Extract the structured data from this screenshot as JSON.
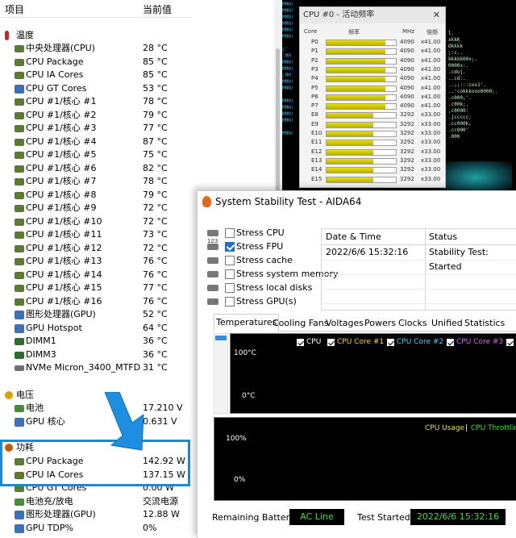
{
  "sensor_panel": {
    "col_item": "项目",
    "col_value": "当前值",
    "sections": {
      "temperature": "温度",
      "voltage": "电压",
      "power": "功耗"
    },
    "temps": [
      {
        "label": "中央处理器(CPU)",
        "value": "28 °C"
      },
      {
        "label": "CPU Package",
        "value": "85 °C"
      },
      {
        "label": "CPU IA Cores",
        "value": "85 °C"
      },
      {
        "label": "CPU GT Cores",
        "value": "53 °C"
      },
      {
        "label": "CPU #1/核心 #1",
        "value": "78 °C"
      },
      {
        "label": "CPU #1/核心 #2",
        "value": "79 °C"
      },
      {
        "label": "CPU #1/核心 #3",
        "value": "77 °C"
      },
      {
        "label": "CPU #1/核心 #4",
        "value": "87 °C"
      },
      {
        "label": "CPU #1/核心 #5",
        "value": "75 °C"
      },
      {
        "label": "CPU #1/核心 #6",
        "value": "82 °C"
      },
      {
        "label": "CPU #1/核心 #7",
        "value": "78 °C"
      },
      {
        "label": "CPU #1/核心 #8",
        "value": "79 °C"
      },
      {
        "label": "CPU #1/核心 #9",
        "value": "72 °C"
      },
      {
        "label": "CPU #1/核心 #10",
        "value": "72 °C"
      },
      {
        "label": "CPU #1/核心 #11",
        "value": "73 °C"
      },
      {
        "label": "CPU #1/核心 #12",
        "value": "72 °C"
      },
      {
        "label": "CPU #1/核心 #13",
        "value": "76 °C"
      },
      {
        "label": "CPU #1/核心 #14",
        "value": "76 °C"
      },
      {
        "label": "CPU #1/核心 #15",
        "value": "77 °C"
      },
      {
        "label": "CPU #1/核心 #16",
        "value": "76 °C"
      },
      {
        "label": "图形处理器(GPU)",
        "value": "52 °C"
      },
      {
        "label": "GPU Hotspot",
        "value": "64 °C"
      },
      {
        "label": "DIMM1",
        "value": "36 °C"
      },
      {
        "label": "DIMM3",
        "value": "36 °C"
      },
      {
        "label": "NVMe Micron_3400_MTFD",
        "value": "31 °C"
      }
    ],
    "volts": [
      {
        "label": "电池",
        "value": "17.210 V"
      },
      {
        "label": "GPU 核心",
        "value": "0.631 V"
      }
    ],
    "power": [
      {
        "label": "CPU Package",
        "value": "142.92 W"
      },
      {
        "label": "CPU IA Cores",
        "value": "137.15 W"
      },
      {
        "label": "CPU GT Cores",
        "value": "0.00 W"
      },
      {
        "label": "电池充/放电",
        "value": "交流电源"
      },
      {
        "label": "图形处理器(GPU)",
        "value": "12.88 W"
      },
      {
        "label": "GPU TDP%",
        "value": "0%"
      }
    ]
  },
  "freq_window": {
    "title": "CPU #0 - 活动频率",
    "close": "✕",
    "col_core": "Core",
    "col_freq": "频率",
    "col_mhz": "MHz",
    "col_mult": "倍频",
    "rows": [
      {
        "core": "P0",
        "mhz": "4090",
        "mult": "x41.00",
        "level": 0.85
      },
      {
        "core": "P1",
        "mhz": "4090",
        "mult": "x41.00",
        "level": 0.85
      },
      {
        "core": "P2",
        "mhz": "4090",
        "mult": "x41.00",
        "level": 0.85
      },
      {
        "core": "P3",
        "mhz": "4090",
        "mult": "x41.00",
        "level": 0.85
      },
      {
        "core": "P4",
        "mhz": "4090",
        "mult": "x41.00",
        "level": 0.85
      },
      {
        "core": "P5",
        "mhz": "4090",
        "mult": "x41.00",
        "level": 0.85
      },
      {
        "core": "P6",
        "mhz": "4090",
        "mult": "x41.00",
        "level": 0.85
      },
      {
        "core": "P7",
        "mhz": "4090",
        "mult": "x41.00",
        "level": 0.85
      },
      {
        "core": "E8",
        "mhz": "3292",
        "mult": "x33.00",
        "level": 0.68
      },
      {
        "core": "E9",
        "mhz": "3292",
        "mult": "x33.00",
        "level": 0.68
      },
      {
        "core": "E10",
        "mhz": "3292",
        "mult": "x33.00",
        "level": 0.68
      },
      {
        "core": "E11",
        "mhz": "3292",
        "mult": "x33.00",
        "level": 0.68
      },
      {
        "core": "E12",
        "mhz": "3292",
        "mult": "x33.00",
        "level": 0.68
      },
      {
        "core": "E13",
        "mhz": "3292",
        "mult": "x33.00",
        "level": 0.68
      },
      {
        "core": "E14",
        "mhz": "3292",
        "mult": "x33.00",
        "level": 0.68
      },
      {
        "core": "E15",
        "mhz": "3292",
        "mult": "x33.00",
        "level": 0.68
      }
    ]
  },
  "terminal": {
    "left_text": "MMN!\nMMN!\nMMN!\nMMN!\nMMN!\nMMN!\n\nc'\n:MM\nMMN!\nMMN!\n;MM\nMMN!\nMMN!\n\nMMN!\nMMN!\nMMN!\nMMN!\n\nMMN!",
    "right_text": "l.\nxkkK\nOkkkk\n;:c..\nkkkkk00x;.\n0000x:.\n.cdoj.\n..cd:.\n..;;:::cox1'.\n..'cokkkooo0000;.\n.c000;'.\n.c00k;.\n,c0000:\n.jccccc:\n.cc000k;\n.cc000'\n.000"
  },
  "sst_window": {
    "title": "System Stability Test - AIDA64",
    "stress": [
      {
        "label": "Stress CPU",
        "checked": false
      },
      {
        "label": "Stress FPU",
        "checked": true
      },
      {
        "label": "Stress cache",
        "checked": false
      },
      {
        "label": "Stress system memory",
        "checked": false
      },
      {
        "label": "Stress local disks",
        "checked": false
      },
      {
        "label": "Stress GPU(s)",
        "checked": false
      }
    ],
    "stress_icon_123": "123",
    "log_headers": {
      "date": "Date & Time",
      "status": "Status"
    },
    "log_rows": [
      {
        "date": "2022/6/6 15:32:16",
        "status": "Stability Test: Started"
      }
    ],
    "tabs": [
      "Temperatures",
      "Cooling Fans",
      "Voltages",
      "Powers",
      "Clocks",
      "Unified",
      "Statistics"
    ],
    "temp_legend": [
      {
        "label": "CPU",
        "color": "#ffffff"
      },
      {
        "label": "CPU Core #1",
        "color": "#ffd23c"
      },
      {
        "label": "CPU Core #2",
        "color": "#3ad7ff"
      },
      {
        "label": "CPU Core #3",
        "color": "#e060ff"
      }
    ],
    "temp_axis": {
      "max": "100°C",
      "min": "0°C"
    },
    "usage_legend": {
      "usage": "CPU Usage",
      "sep": "|",
      "throttle": "CPU Throttling",
      "usage_color": "#e8e020",
      "throttle_color": "#36e236"
    },
    "usage_axis": {
      "max": "100%",
      "min": "0%"
    },
    "footer": {
      "battery_label": "Remaining Battery:",
      "battery_value": "AC Line",
      "started_label": "Test Started:",
      "started_value": "2022/6/6 15:32:16"
    }
  }
}
